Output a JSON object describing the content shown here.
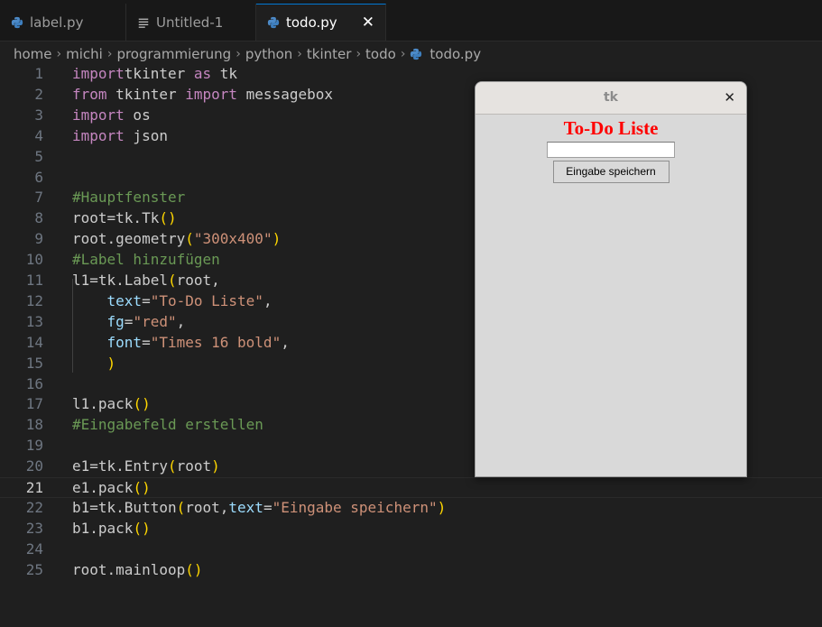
{
  "tabs": [
    {
      "label": "label.py",
      "icon": "python-icon",
      "active": false
    },
    {
      "label": "Untitled-1",
      "icon": "text-lines-icon",
      "active": false
    },
    {
      "label": "todo.py",
      "icon": "python-icon",
      "active": true,
      "close": "✕"
    }
  ],
  "breadcrumb": [
    "home",
    "michi",
    "programmierung",
    "python",
    "tkinter",
    "todo",
    "todo.py"
  ],
  "colors": {
    "keyword": "#c586c0",
    "string": "#ce9178",
    "comment": "#6a9955",
    "bracket": "#ffd700",
    "param": "#9cdcfe",
    "accent": "#0078d4"
  },
  "editor": {
    "current_line": 21,
    "lines": [
      {
        "n": "1",
        "parts": [
          [
            "kw",
            "import"
          ],
          [
            "",
            "tkinter "
          ],
          [
            "kw",
            "as"
          ],
          [
            "",
            " tk"
          ]
        ]
      },
      {
        "n": "2",
        "parts": [
          [
            "kw",
            "from"
          ],
          [
            "",
            " tkinter "
          ],
          [
            "kw",
            "import"
          ],
          [
            "",
            " messagebox"
          ]
        ]
      },
      {
        "n": "3",
        "parts": [
          [
            "kw",
            "import"
          ],
          [
            "",
            " os"
          ]
        ]
      },
      {
        "n": "4",
        "parts": [
          [
            "kw",
            "import"
          ],
          [
            "",
            " json"
          ]
        ]
      },
      {
        "n": "5",
        "parts": []
      },
      {
        "n": "6",
        "parts": []
      },
      {
        "n": "7",
        "parts": [
          [
            "cm",
            "#Hauptfenster"
          ]
        ]
      },
      {
        "n": "8",
        "parts": [
          [
            "",
            "root=tk.Tk"
          ],
          [
            "par",
            "()"
          ]
        ]
      },
      {
        "n": "9",
        "parts": [
          [
            "",
            "root.geometry"
          ],
          [
            "par",
            "("
          ],
          [
            "str",
            "\"300x400\""
          ],
          [
            "par",
            ")"
          ]
        ]
      },
      {
        "n": "10",
        "parts": [
          [
            "cm",
            "#Label hinzufügen"
          ]
        ]
      },
      {
        "n": "11",
        "parts": [
          [
            "",
            "l1=tk.Label"
          ],
          [
            "par",
            "("
          ],
          [
            "",
            "root,"
          ]
        ]
      },
      {
        "n": "12",
        "parts": [
          [
            "",
            "    "
          ],
          [
            "prm",
            "text"
          ],
          [
            "",
            "="
          ],
          [
            "str",
            "\"To-Do Liste\""
          ],
          [
            "",
            ","
          ]
        ]
      },
      {
        "n": "13",
        "parts": [
          [
            "",
            "    "
          ],
          [
            "prm",
            "fg"
          ],
          [
            "",
            "="
          ],
          [
            "str",
            "\"red\""
          ],
          [
            "",
            ","
          ]
        ]
      },
      {
        "n": "14",
        "parts": [
          [
            "",
            "    "
          ],
          [
            "prm",
            "font"
          ],
          [
            "",
            "="
          ],
          [
            "str",
            "\"Times 16 bold\""
          ],
          [
            "",
            ","
          ]
        ]
      },
      {
        "n": "15",
        "parts": [
          [
            "",
            "    "
          ],
          [
            "par",
            ")"
          ]
        ]
      },
      {
        "n": "16",
        "parts": []
      },
      {
        "n": "17",
        "parts": [
          [
            "",
            "l1.pack"
          ],
          [
            "par",
            "()"
          ]
        ]
      },
      {
        "n": "18",
        "parts": [
          [
            "cm",
            "#Eingabefeld erstellen"
          ]
        ]
      },
      {
        "n": "19",
        "parts": []
      },
      {
        "n": "20",
        "parts": [
          [
            "",
            "e1=tk.Entry"
          ],
          [
            "par",
            "("
          ],
          [
            "",
            "root"
          ],
          [
            "par",
            ")"
          ]
        ]
      },
      {
        "n": "21",
        "parts": [
          [
            "",
            "e1.pack"
          ],
          [
            "par",
            "()"
          ]
        ]
      },
      {
        "n": "22",
        "parts": [
          [
            "",
            "b1=tk.Button"
          ],
          [
            "par",
            "("
          ],
          [
            "",
            "root,"
          ],
          [
            "prm",
            "text"
          ],
          [
            "",
            "="
          ],
          [
            "str",
            "\"Eingabe speichern\""
          ],
          [
            "par",
            ")"
          ]
        ]
      },
      {
        "n": "23",
        "parts": [
          [
            "",
            "b1.pack"
          ],
          [
            "par",
            "()"
          ]
        ]
      },
      {
        "n": "24",
        "parts": []
      },
      {
        "n": "25",
        "parts": [
          [
            "",
            "root.mainloop"
          ],
          [
            "par",
            "()"
          ]
        ]
      }
    ]
  },
  "tk_window": {
    "title": "tk",
    "close": "✕",
    "label": "To-Do Liste",
    "label_color": "#ff0000",
    "entry_value": "",
    "button": "Eingabe speichern"
  }
}
